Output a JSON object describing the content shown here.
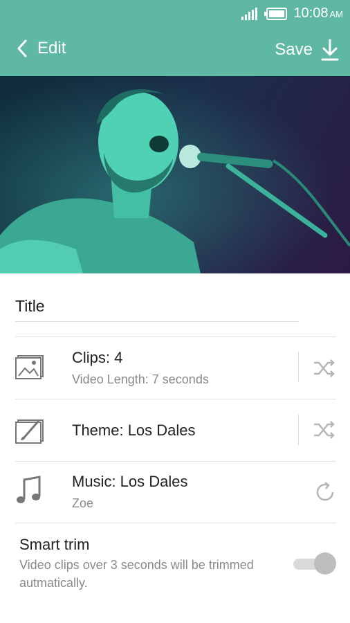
{
  "status_bar": {
    "time": "10:08",
    "ampm": "AM"
  },
  "app_bar": {
    "back_label": "Edit",
    "save_label": "Save"
  },
  "title_field": {
    "value": "Title"
  },
  "rows": [
    {
      "main": "Clips: 4",
      "sub": "Video Length: 7 seconds",
      "icon": "image-icon",
      "action_icon": "shuffle-icon"
    },
    {
      "main": "Theme: Los Dales",
      "sub": "",
      "icon": "theme-brush-icon",
      "action_icon": "shuffle-icon"
    },
    {
      "main": "Music: Los Dales",
      "sub": "Zoe",
      "icon": "music-note-icon",
      "action_icon": "refresh-icon"
    }
  ],
  "smart_trim": {
    "label": "Smart trim",
    "description": "Video clips over 3 seconds will be trimmed autmatically.",
    "enabled": false
  },
  "colors": {
    "accent": "#5fb8a4",
    "hero_tint": "#3fd0b0"
  }
}
